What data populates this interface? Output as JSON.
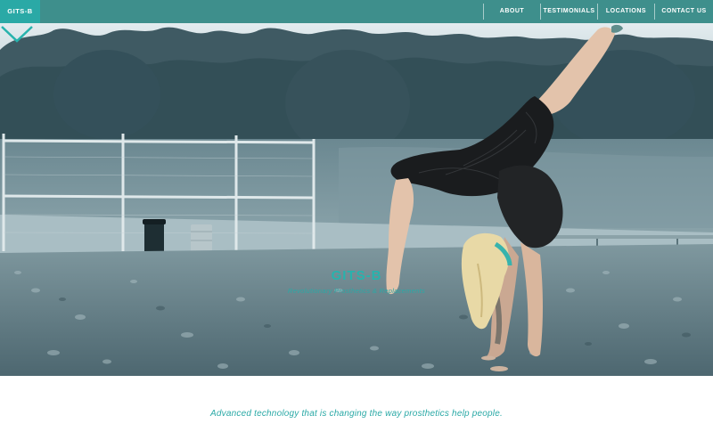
{
  "nav": {
    "brand": "GITS-B",
    "items": [
      {
        "label": "ABOUT"
      },
      {
        "label": "TESTIMONIALS"
      },
      {
        "label": "LOCATIONS"
      },
      {
        "label": "CONTACT US"
      }
    ]
  },
  "hero": {
    "title": "GITS-B",
    "subtitle": "Revolutionary Prosthetics & Replacements",
    "scroll_icon": "chevron-down-icon"
  },
  "intro": {
    "tagline": "Advanced technology that is changing the way prosthetics help people."
  },
  "colors": {
    "accent": "#2aa9a6",
    "nav_bg": "#3e8f8c",
    "brand_bg": "#2aa9a6"
  }
}
